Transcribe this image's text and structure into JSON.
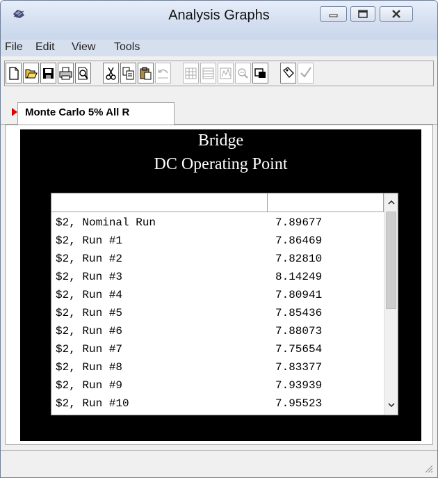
{
  "window": {
    "title": "Analysis Graphs"
  },
  "menu": [
    "File",
    "Edit",
    "View",
    "Tools"
  ],
  "toolbar": {
    "buttons": [
      "new-icon",
      "open-icon",
      "save-icon",
      "print-icon",
      "print-preview-icon",
      "cut-icon",
      "copy-icon",
      "paste-icon",
      "undo-icon",
      "grid-icon",
      "table-icon",
      "chart-icon",
      "zoom-out-icon",
      "window-icon",
      "tag-icon",
      "check-icon"
    ],
    "disabled": [
      "undo-icon",
      "grid-icon",
      "table-icon",
      "chart-icon",
      "zoom-out-icon",
      "check-icon"
    ]
  },
  "tab": {
    "label": "Monte Carlo 5% All R"
  },
  "graph": {
    "title": "Bridge",
    "subtitle": "DC Operating Point",
    "headers": [
      "",
      ""
    ],
    "rows": [
      {
        "name": "$2, Nominal Run",
        "value": "7.89677"
      },
      {
        "name": "$2, Run #1",
        "value": "7.86469"
      },
      {
        "name": "$2, Run #2",
        "value": "7.82810"
      },
      {
        "name": "$2, Run #3",
        "value": "8.14249"
      },
      {
        "name": "$2, Run #4",
        "value": "7.80941"
      },
      {
        "name": "$2, Run #5",
        "value": "7.85436"
      },
      {
        "name": "$2, Run #6",
        "value": "7.88073"
      },
      {
        "name": "$2, Run #7",
        "value": "7.75654"
      },
      {
        "name": "$2, Run #8",
        "value": "7.83377"
      },
      {
        "name": "$2, Run #9",
        "value": "7.93939"
      },
      {
        "name": "$2, Run #10",
        "value": "7.95523"
      }
    ]
  },
  "colors": {
    "titlebar": "#d4dff0",
    "plot_background": "#000000",
    "tab_marker": "#e00000"
  }
}
